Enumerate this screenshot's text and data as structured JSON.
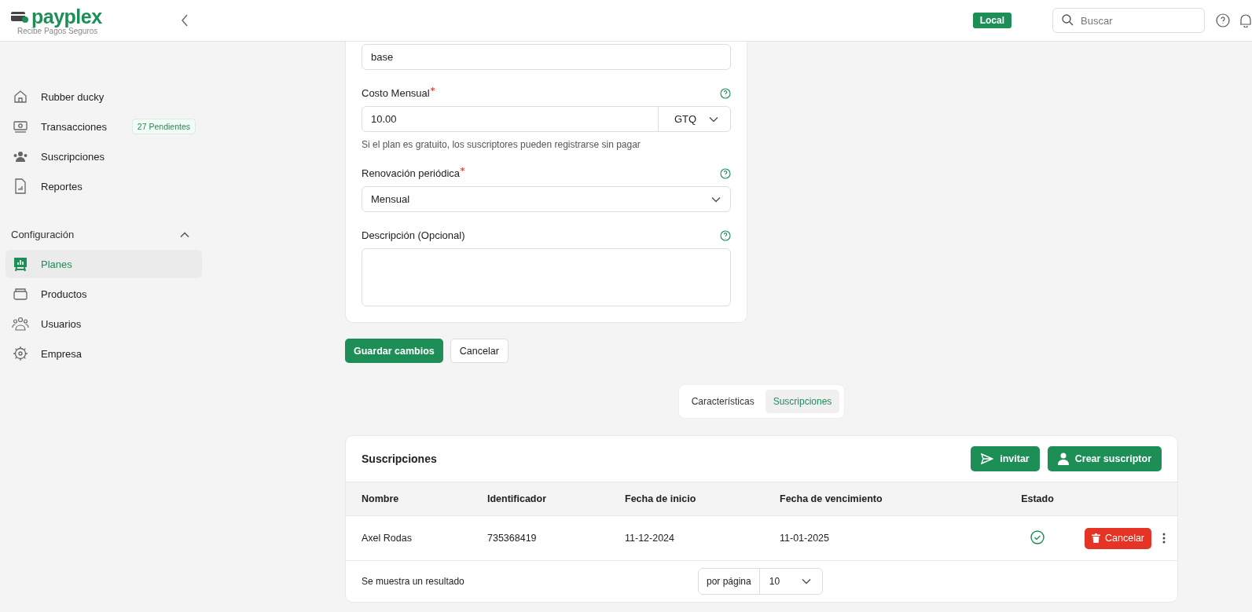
{
  "header": {
    "brand": "payplex",
    "tagline": "Recibe Pagos Seguros",
    "environment": "Local",
    "search": {
      "placeholder": "Buscar"
    }
  },
  "sidebar": {
    "items": [
      {
        "label": "Rubber ducky",
        "selected": false
      },
      {
        "label": "Transacciones",
        "badge": "27 Pendientes",
        "selected": false
      },
      {
        "label": "Suscripciones",
        "selected": false
      },
      {
        "label": "Reportes",
        "selected": false
      }
    ],
    "section": {
      "title": "Configuración",
      "expanded": true,
      "items": [
        {
          "label": "Planes",
          "selected": true
        },
        {
          "label": "Productos",
          "selected": false
        },
        {
          "label": "Usuarios",
          "selected": false
        },
        {
          "label": "Empresa",
          "selected": false
        }
      ]
    }
  },
  "form": {
    "fields": [
      {
        "kind": "text",
        "value": "base"
      },
      {
        "kind": "money",
        "label": "Costo Mensual",
        "required": true,
        "help": true,
        "value": "10.00",
        "currency": "GTQ",
        "hint": "Si el plan es gratuito, los suscriptores pueden registrarse sin pagar"
      },
      {
        "kind": "select",
        "label": "Renovación periódica",
        "required": true,
        "help": true,
        "value": "Mensual"
      },
      {
        "kind": "textarea",
        "label": "Descripción (Opcional)",
        "required": false,
        "help": true
      }
    ],
    "buttons": [
      {
        "label": "Guardar cambios",
        "kind": "primary"
      },
      {
        "label": "Cancelar",
        "kind": "secondary"
      }
    ]
  },
  "tabs": [
    {
      "label": "Características",
      "selected": false
    },
    {
      "label": "Suscripciones",
      "selected": true
    }
  ],
  "subscriptions": {
    "title": "Suscripciones",
    "actions": [
      {
        "label": "invitar"
      },
      {
        "label": "Crear suscriptor"
      }
    ],
    "columns": [
      "Nombre",
      "Identificador",
      "Fecha de inicio",
      "Fecha de vencimiento",
      "Estado"
    ],
    "rows": [
      {
        "cells": [
          "Axel Rodas",
          "735368419",
          "11-12-2024",
          "11-01-2025"
        ],
        "active": true,
        "action": "Cancelar"
      }
    ],
    "footer": "Se muestra un resultado",
    "per_page_label": "por página",
    "per_page": "10"
  }
}
